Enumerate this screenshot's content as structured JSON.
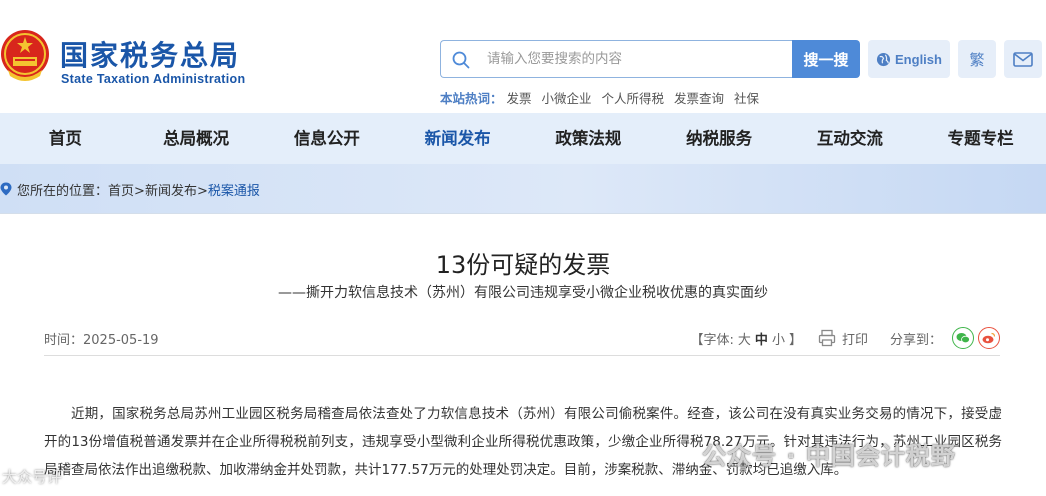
{
  "header": {
    "site_name": "国家税务总局",
    "site_name_en": "State Taxation Administration",
    "search_placeholder": "请输入您要搜索的内容",
    "search_button": "搜一搜",
    "english_button": "English",
    "traditional_button": "繁",
    "hot_search_label": "本站热词：",
    "hot_search_items": [
      "发票",
      "小微企业",
      "个人所得税",
      "发票查询",
      "社保"
    ]
  },
  "nav": {
    "items": [
      "首页",
      "总局概况",
      "信息公开",
      "新闻发布",
      "政策法规",
      "纳税服务",
      "互动交流",
      "专题专栏"
    ],
    "active_index": 3
  },
  "breadcrumb": {
    "prefix": "您所在的位置：",
    "home": "首页",
    "sep1": ">",
    "section": "新闻发布",
    "sep2": ">",
    "current": "税案通报"
  },
  "article": {
    "title": "13份可疑的发票",
    "subtitle": "——撕开力软信息技术（苏州）有限公司违规享受小微企业税收优惠的真实面纱",
    "date": "时间：2025-05-19",
    "font_label": "【字体:",
    "font_large": "大",
    "font_medium": "中",
    "font_small": "小",
    "font_close": "】",
    "print_label": "打印",
    "share_label": "分享到：",
    "body": "近期，国家税务总局苏州工业园区税务局稽查局依法查处了力软信息技术（苏州）有限公司偷税案件。经查，该公司在没有真实业务交易的情况下，接受虚开的13份增值税普通发票并在企业所得税税前列支，违规享受小型微利企业所得税优惠政策，少缴企业所得税78.27万元。针对其违法行为，苏州工业园区税务局稽查局依法作出追缴税款、加收滞纳金并处罚款，共计177.57万元的处理处罚决定。目前，涉案税款、滞纳金、罚款均已追缴入库。"
  },
  "watermark": {
    "text": "公众号 · 中国会计税野",
    "text2": "大众号评"
  },
  "colors": {
    "brand_blue": "#1a56a8",
    "button_blue": "#4e8ad8",
    "nav_bg": "#e4eefa",
    "wechat_green": "#3fb54a",
    "weibo_red": "#e9523f"
  }
}
